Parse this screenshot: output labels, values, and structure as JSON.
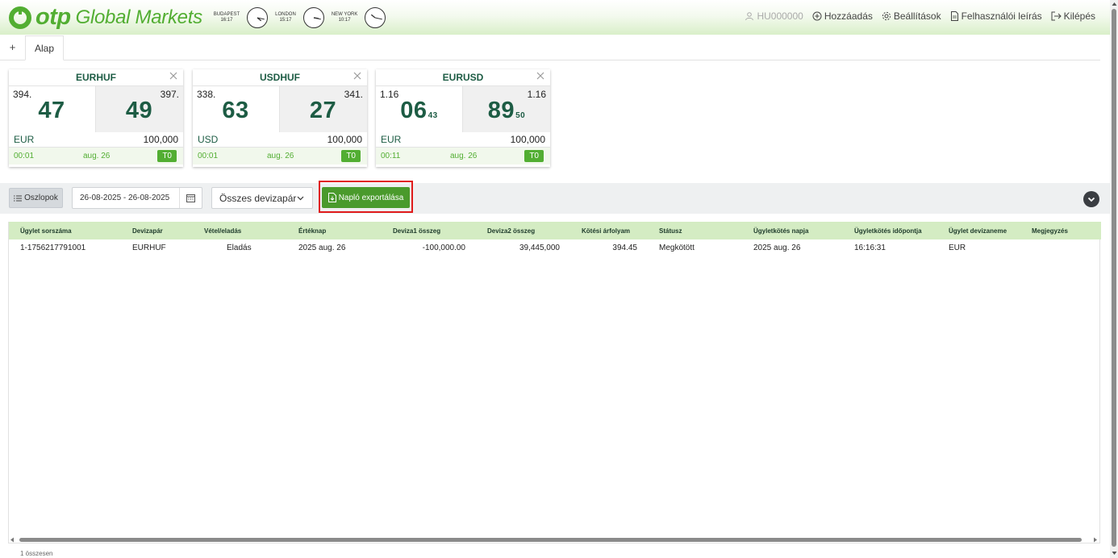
{
  "brand": {
    "otp": "otp",
    "global_markets": "Global Markets",
    "color": "#52ae32"
  },
  "clocks": [
    {
      "city": "BUDAPEST",
      "time": "16:17",
      "hour": 16,
      "minute": 17
    },
    {
      "city": "LONDON",
      "time": "15:17",
      "hour": 15,
      "minute": 17
    },
    {
      "city": "NEW YORK",
      "time": "10:17",
      "hour": 10,
      "minute": 17
    }
  ],
  "header": {
    "user": "HU000000",
    "add": "Hozzáadás",
    "settings": "Beállítások",
    "manual": "Felhasználói leírás",
    "logout": "Kilépés"
  },
  "tabs": {
    "add": "+",
    "active": "Alap"
  },
  "tiles": [
    {
      "pair": "EURHUF",
      "sell_small": "394.",
      "sell_big": "47",
      "sell_pip": "",
      "buy_small": "397.",
      "buy_big": "49",
      "buy_pip": "",
      "ccy": "EUR",
      "amount": "100,000",
      "time": "00:01",
      "date": "aug. 26",
      "tenor": "T0"
    },
    {
      "pair": "USDHUF",
      "sell_small": "338.",
      "sell_big": "63",
      "sell_pip": "",
      "buy_small": "341.",
      "buy_big": "27",
      "buy_pip": "",
      "ccy": "USD",
      "amount": "100,000",
      "time": "00:01",
      "date": "aug. 26",
      "tenor": "T0"
    },
    {
      "pair": "EURUSD",
      "sell_small": "1.16",
      "sell_big": "06",
      "sell_pip": "43",
      "buy_small": "1.16",
      "buy_big": "89",
      "buy_pip": "50",
      "ccy": "EUR",
      "amount": "100,000",
      "time": "00:11",
      "date": "aug. 26",
      "tenor": "T0"
    }
  ],
  "toolbar": {
    "columns": "Oszlopok",
    "date_range": "26-08-2025 - 26-08-2025",
    "pair_select": "Összes devizapár",
    "export": "Napló exportálása"
  },
  "grid": {
    "columns": [
      "Ügylet sorszáma",
      "Devizapár",
      "Vétel/eladás",
      "Értéknap",
      "Deviza1 összeg",
      "Deviza2 összeg",
      "Kötési árfolyam",
      "Státusz",
      "Ügyletkötés napja",
      "Ügyletkötés időpontja",
      "Ügylet devizaneme",
      "Megjegyzés"
    ],
    "rows": [
      [
        "1-1756217791001",
        "EURHUF",
        "Eladás",
        "2025 aug. 26",
        "-100,000.00",
        "39,445,000",
        "394.45",
        "Megkötött",
        "2025 aug. 26",
        "16:16:31",
        "EUR",
        ""
      ]
    ],
    "total": "1 összesen"
  }
}
